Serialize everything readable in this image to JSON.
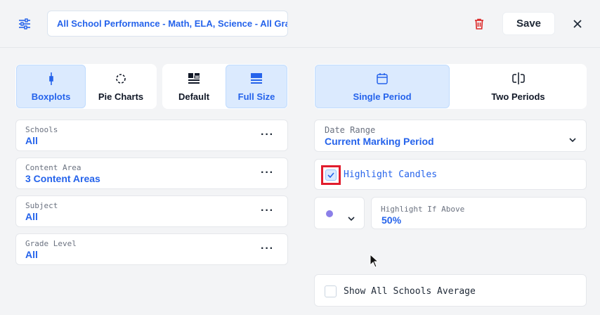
{
  "header": {
    "title_value": "All School Performance - Math, ELA, Science - All Grades",
    "save_label": "Save",
    "icons": {
      "filter": "sliders-icon",
      "delete": "trash-icon",
      "close": "close-icon"
    }
  },
  "view_modes": [
    {
      "label": "Boxplots",
      "active": true,
      "icon": "boxplot-icon"
    },
    {
      "label": "Pie Charts",
      "active": false,
      "icon": "pie-chart-icon"
    }
  ],
  "size_modes": [
    {
      "label": "Default",
      "active": false,
      "icon": "layout-icon"
    },
    {
      "label": "Full Size",
      "active": true,
      "icon": "full-size-icon"
    }
  ],
  "period_modes": [
    {
      "label": "Single Period",
      "active": true,
      "icon": "calendar-icon"
    },
    {
      "label": "Two Periods",
      "active": false,
      "icon": "split-icon"
    }
  ],
  "filters": [
    {
      "label": "Schools",
      "value": "All"
    },
    {
      "label": "Content Area",
      "value": "3 Content Areas"
    },
    {
      "label": "Subject",
      "value": "All"
    },
    {
      "label": "Grade Level",
      "value": "All"
    }
  ],
  "more_label": "···",
  "date_range": {
    "label": "Date Range",
    "value": "Current Marking Period"
  },
  "highlight_candles": {
    "label": "Highlight Candles",
    "checked": true
  },
  "highlight_if_above": {
    "label": "Highlight If Above",
    "value": "50%"
  },
  "show_all_average": {
    "label": "Show All Schools Average",
    "checked": false
  },
  "colors": {
    "accent": "#2563eb",
    "active_bg": "#dbeafe",
    "danger": "#dc2626",
    "swatch": "#8b7fe8",
    "annotation": "#e11d2e"
  }
}
